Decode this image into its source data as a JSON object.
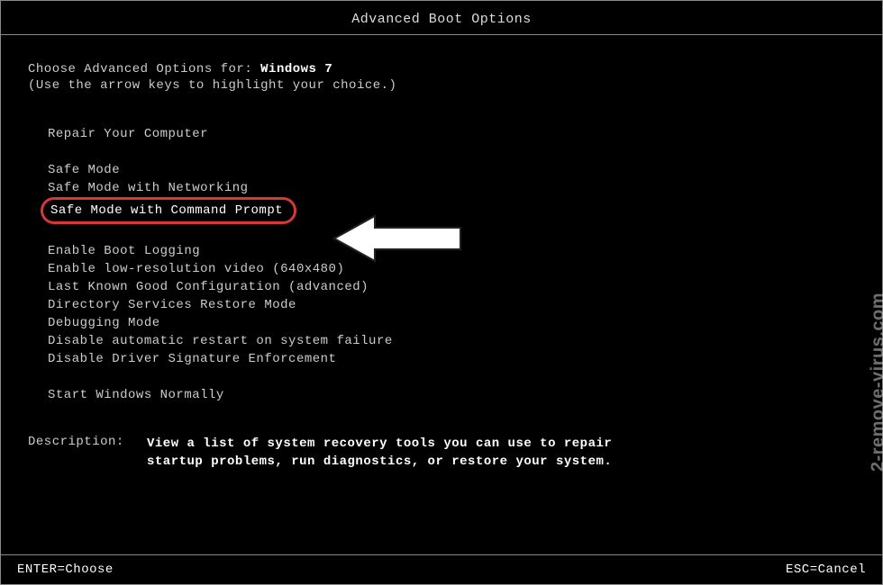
{
  "title": "Advanced Boot Options",
  "choose_prefix": "Choose Advanced Options for: ",
  "os_name": "Windows 7",
  "instruction": "(Use the arrow keys to highlight your choice.)",
  "menu": {
    "group1": [
      "Repair Your Computer"
    ],
    "group2": [
      "Safe Mode",
      "Safe Mode with Networking"
    ],
    "highlighted": "Safe Mode with Command Prompt",
    "group3": [
      "Enable Boot Logging",
      "Enable low-resolution video (640x480)",
      "Last Known Good Configuration (advanced)",
      "Directory Services Restore Mode",
      "Debugging Mode",
      "Disable automatic restart on system failure",
      "Disable Driver Signature Enforcement"
    ],
    "group4": [
      "Start Windows Normally"
    ]
  },
  "description": {
    "label": "Description:",
    "text": "View a list of system recovery tools you can use to repair startup problems, run diagnostics, or restore your system."
  },
  "footer": {
    "enter": "ENTER=Choose",
    "esc": "ESC=Cancel"
  },
  "watermark": "2-remove-virus.com"
}
